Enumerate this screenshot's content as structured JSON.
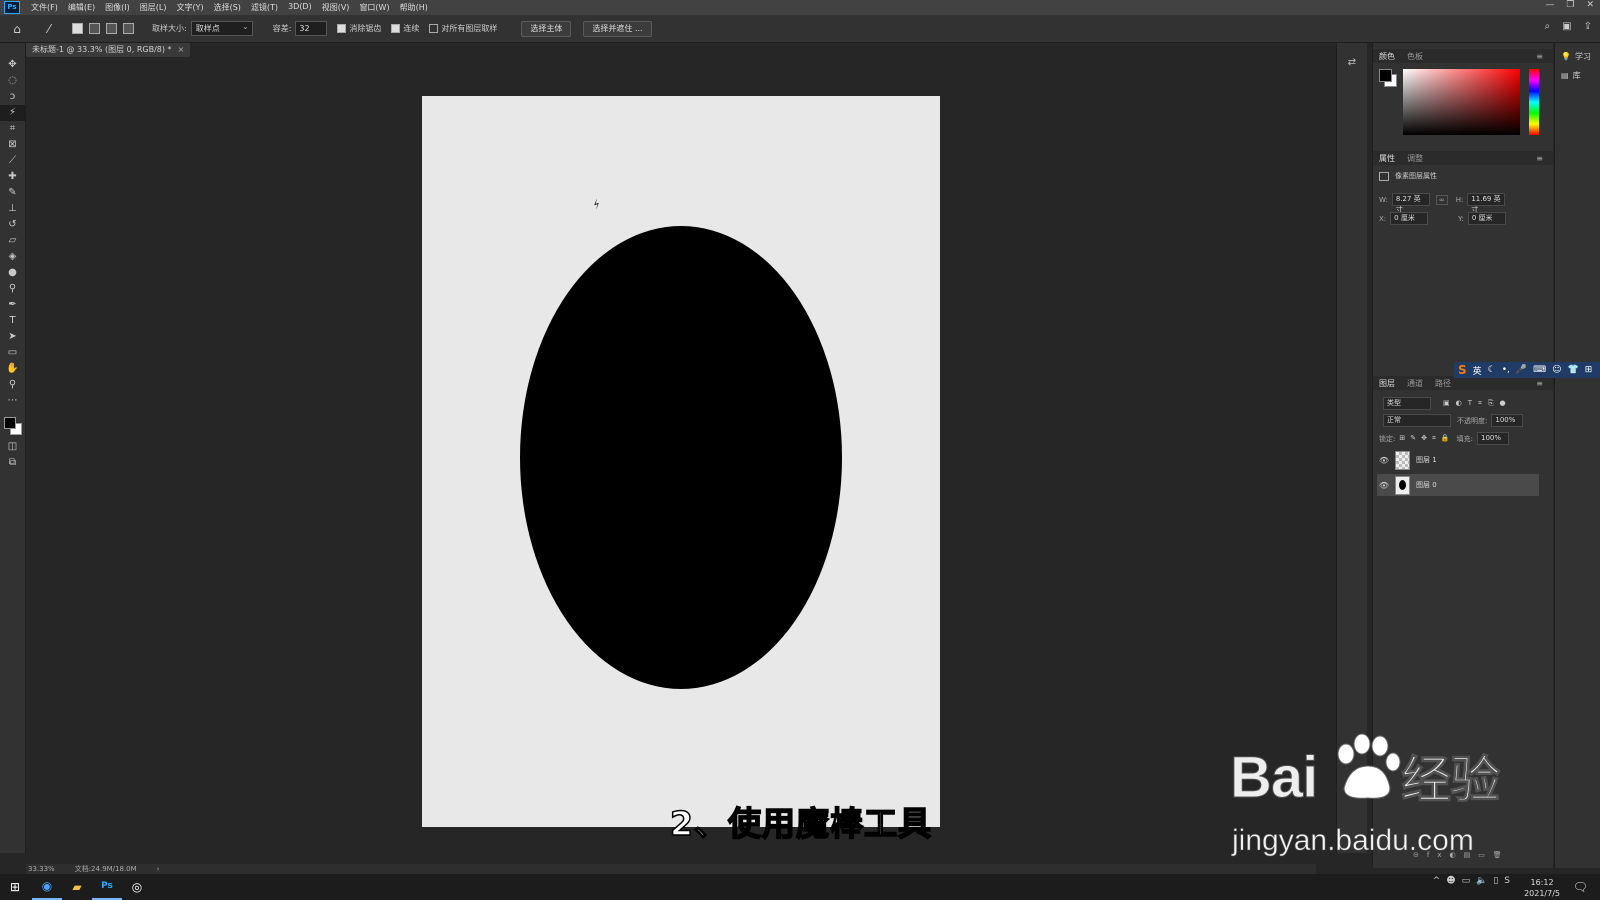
{
  "app": {
    "logo": "Ps"
  },
  "menubar": {
    "items": [
      "文件(F)",
      "编辑(E)",
      "图像(I)",
      "图层(L)",
      "文字(Y)",
      "选择(S)",
      "滤镜(T)",
      "3D(D)",
      "视图(V)",
      "窗口(W)",
      "帮助(H)"
    ],
    "window_buttons": [
      "—",
      "❐",
      "✕"
    ]
  },
  "options": {
    "sample_size_label": "取样大小:",
    "sample_size_value": "取样点",
    "tolerance_label": "容差:",
    "tolerance_value": "32",
    "antialias_label": "消除锯齿",
    "contiguous_label": "连续",
    "sample_all_label": "对所有图层取样",
    "select_subject_label": "选择主体",
    "select_mask_label": "选择并遮住 ..."
  },
  "document": {
    "tab_title": "未标题-1 @ 33.3% (图层 0, RGB/8) *",
    "zoom": "33.33%",
    "doc_size": "文档:24.9M/18.0M"
  },
  "panels": {
    "color_tabs": [
      "颜色",
      "色板"
    ],
    "props_tabs": [
      "属性",
      "调整"
    ],
    "props_title": "像素图层属性",
    "w_label": "W:",
    "w_value": "8.27 英寸",
    "h_label": "H:",
    "h_value": "11.69 英寸",
    "x_label": "X:",
    "x_value": "0 厘米",
    "y_label": "Y:",
    "y_value": "0 厘米",
    "layers_tabs": [
      "图层",
      "通道",
      "路径"
    ],
    "kind_filter": "类型",
    "blend_mode": "正常",
    "opacity_label": "不透明度:",
    "opacity_value": "100%",
    "lock_label": "锁定:",
    "fill_label": "填充:",
    "fill_value": "100%",
    "layers": [
      {
        "name": "图层 1",
        "selected": false
      },
      {
        "name": "图层 0",
        "selected": true
      }
    ],
    "learn_label": "学习",
    "library_label": "库"
  },
  "ime": {
    "lang": "英"
  },
  "caption": "2、使用魔棒工具",
  "watermark": {
    "brand": "Bai",
    "brand2": "经验",
    "url": "jingyan.baidu.com"
  },
  "taskbar": {
    "time": "16:12",
    "date": "2021/7/5"
  },
  "colors": {
    "accent_ps": "#31a8ff",
    "canvas_bg": "#e8e8e8",
    "ellipse": "#000000",
    "ui_dark": "#323232"
  }
}
